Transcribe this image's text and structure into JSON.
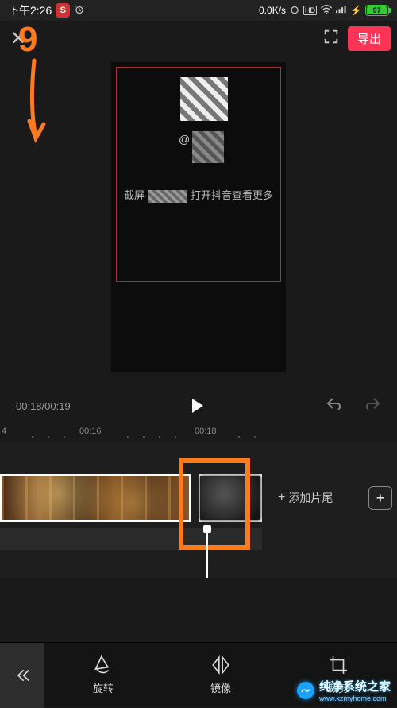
{
  "status": {
    "time": "下午2:26",
    "net_speed": "0.0K/s",
    "battery_pct": "97"
  },
  "topbar": {
    "export_label": "导出"
  },
  "preview": {
    "at_symbol": "@",
    "hint_prefix": "截屏",
    "hint_suffix": "打开抖音查看更多"
  },
  "playback": {
    "current": "00:18",
    "total": "00:19",
    "separator": "/"
  },
  "ruler": {
    "t0": "4",
    "t1": "00:16",
    "t2": "00:18"
  },
  "timeline": {
    "add_tail_label": "添加片尾",
    "plus_label": "+"
  },
  "tools": {
    "rotate_label": "旋转",
    "mirror_label": "镜像",
    "crop_label": "裁剪"
  },
  "watermark": {
    "text": "纯净系统之家",
    "url": "www.kzmyhome.com"
  },
  "step": {
    "number": "9"
  }
}
